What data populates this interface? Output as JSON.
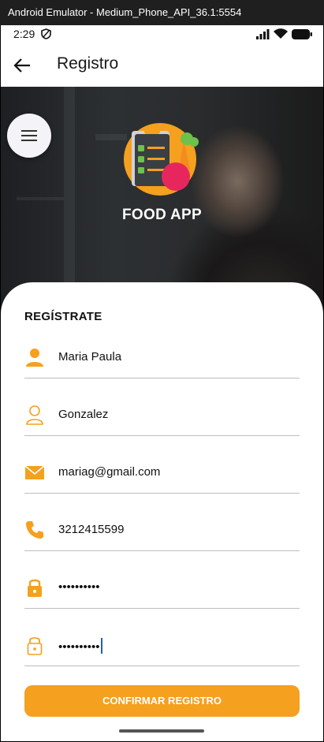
{
  "window": {
    "title": "Android Emulator - Medium_Phone_API_36.1:5554"
  },
  "status_bar": {
    "time": "2:29"
  },
  "app_bar": {
    "title": "Registro"
  },
  "hero": {
    "brand": "FOOD APP"
  },
  "form": {
    "title": "REGÍSTRATE",
    "fields": [
      {
        "icon": "person-filled-icon",
        "value": "Maria Paula"
      },
      {
        "icon": "person-outline-icon",
        "value": "Gonzalez"
      },
      {
        "icon": "mail-icon",
        "value": "mariag@gmail.com"
      },
      {
        "icon": "phone-icon",
        "value": "3212415599"
      },
      {
        "icon": "lock-filled-icon",
        "value": "••••••••••"
      },
      {
        "icon": "lock-outline-icon",
        "value": "••••••••••"
      }
    ],
    "confirm_label": "CONFIRMAR REGISTRO"
  },
  "colors": {
    "accent": "#F5A01E",
    "background": "#FFFFFF"
  }
}
